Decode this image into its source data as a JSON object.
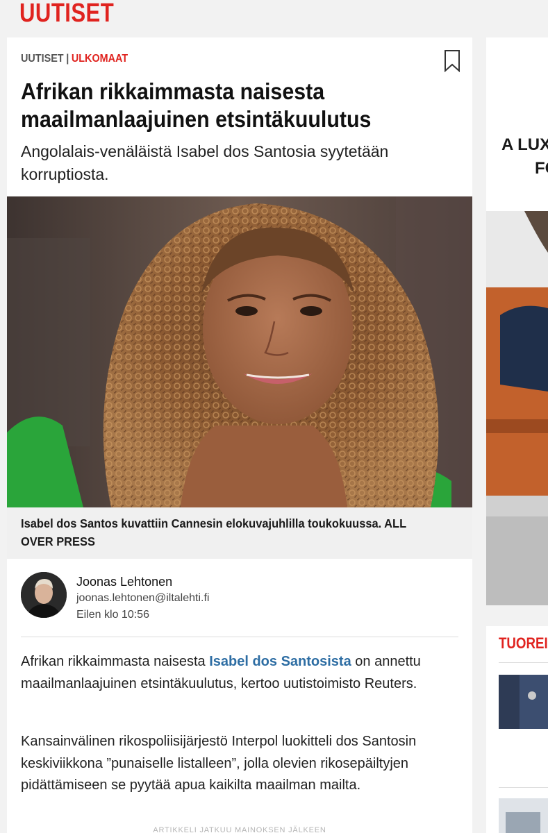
{
  "site": {
    "section_title": "UUTISET"
  },
  "article": {
    "breadcrumb": {
      "section": "UUTISET",
      "separator": "|",
      "subsection": "ULKOMAAT"
    },
    "headline": "Afrikan rikkaimmasta naisesta maailmanlaajuinen etsintäkuulutus",
    "lead": "Angolalais-venäläistä Isabel dos Santosia syytetään korruptiosta.",
    "image_caption": "Isabel dos Santos kuvattiin Cannesin elokuvajuhlilla toukokuussa. ALL OVER PRESS",
    "author": {
      "name": "Joonas Lehtonen",
      "email": "joonas.lehtonen@iltalehti.fi",
      "published": "Eilen klo 10:56"
    },
    "paragraph1": {
      "before": "Afrikan rikkaimmasta naisesta ",
      "link": "Isabel dos Santosista",
      "after": " on annettu maailmanlaajuinen etsintäkuulutus, kertoo uutistoimisto Reuters."
    },
    "paragraph2": "Kansainvälinen rikospoliisijärjestö Interpol luokitteli dos Santosin keskiviikkona ”punaiselle listalleen”, jolla olevien rikosepäiltyjen pidättämiseen se pyytää apua kaikilta maailman mailta.",
    "continues_notice": "ARTIKKELI JATKUU MAINOKSEN JÄLKEEN"
  },
  "sidebar": {
    "ad_line1": "A LUX",
    "ad_line2": "FO",
    "latest_title": "TUOREI"
  },
  "colors": {
    "brand_red": "#e0231f",
    "link_blue": "#2d6da3"
  },
  "icons": {
    "bookmark": "bookmark-icon"
  }
}
